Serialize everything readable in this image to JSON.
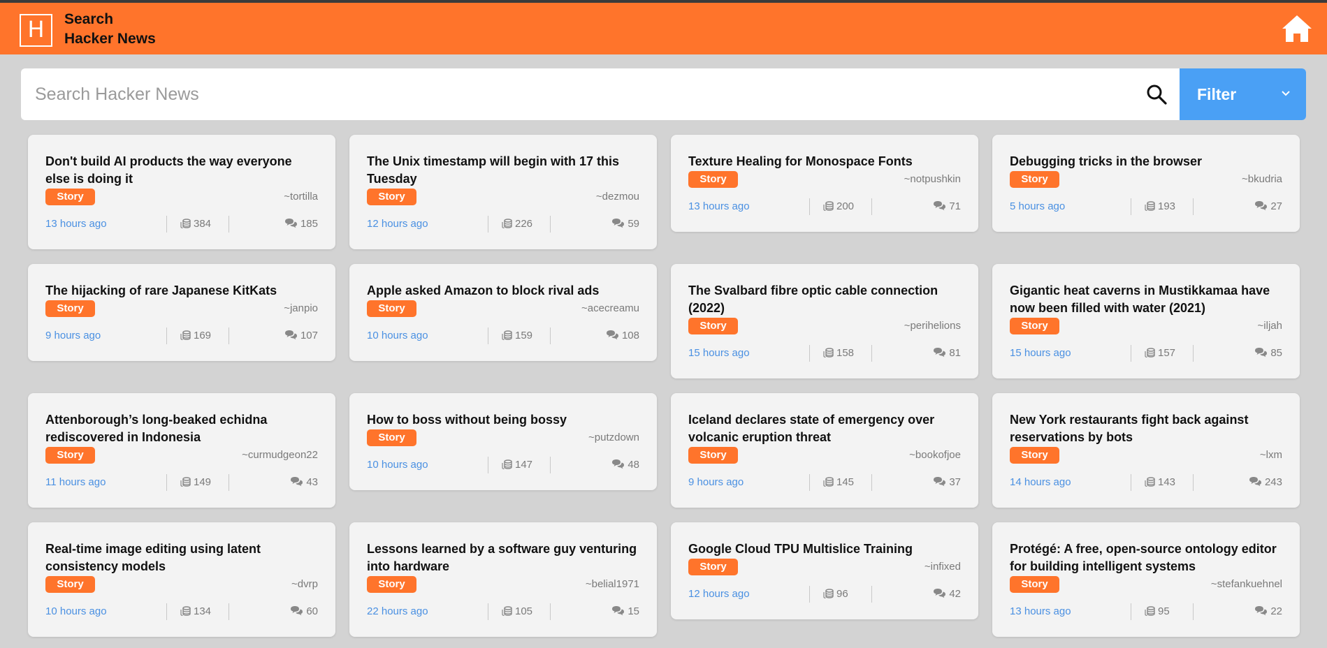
{
  "header": {
    "brand_line1": "Search",
    "brand_line2": "Hacker News",
    "logo_letter": "H"
  },
  "search": {
    "placeholder": "Search Hacker News",
    "filter_label": "Filter"
  },
  "colors": {
    "brand": "#ff742b",
    "filter": "#4aa0f5",
    "time": "#4a90e2"
  },
  "stories": [
    {
      "title": "Don't build AI products the way everyone else is doing it",
      "tag": "Story",
      "author": "~tortilla",
      "time": "13 hours ago",
      "points": "384",
      "comments": "185"
    },
    {
      "title": "The Unix timestamp will begin with 17 this Tuesday",
      "tag": "Story",
      "author": "~dezmou",
      "time": "12 hours ago",
      "points": "226",
      "comments": "59"
    },
    {
      "title": "Texture Healing for Monospace Fonts",
      "tag": "Story",
      "author": "~notpushkin",
      "time": "13 hours ago",
      "points": "200",
      "comments": "71"
    },
    {
      "title": "Debugging tricks in the browser",
      "tag": "Story",
      "author": "~bkudria",
      "time": "5 hours ago",
      "points": "193",
      "comments": "27"
    },
    {
      "title": "The hijacking of rare Japanese KitKats",
      "tag": "Story",
      "author": "~janpio",
      "time": "9 hours ago",
      "points": "169",
      "comments": "107"
    },
    {
      "title": "Apple asked Amazon to block rival ads",
      "tag": "Story",
      "author": "~acecreamu",
      "time": "10 hours ago",
      "points": "159",
      "comments": "108"
    },
    {
      "title": "The Svalbard fibre optic cable connection (2022)",
      "tag": "Story",
      "author": "~perihelions",
      "time": "15 hours ago",
      "points": "158",
      "comments": "81"
    },
    {
      "title": "Gigantic heat caverns in Mustikkamaa have now been filled with water (2021)",
      "tag": "Story",
      "author": "~iljah",
      "time": "15 hours ago",
      "points": "157",
      "comments": "85"
    },
    {
      "title": "Attenborough’s long-beaked echidna rediscovered in Indonesia",
      "tag": "Story",
      "author": "~curmudgeon22",
      "time": "11 hours ago",
      "points": "149",
      "comments": "43"
    },
    {
      "title": "How to boss without being bossy",
      "tag": "Story",
      "author": "~putzdown",
      "time": "10 hours ago",
      "points": "147",
      "comments": "48"
    },
    {
      "title": "Iceland declares state of emergency over volcanic eruption threat",
      "tag": "Story",
      "author": "~bookofjoe",
      "time": "9 hours ago",
      "points": "145",
      "comments": "37"
    },
    {
      "title": "New York restaurants fight back against reservations by bots",
      "tag": "Story",
      "author": "~lxm",
      "time": "14 hours ago",
      "points": "143",
      "comments": "243"
    },
    {
      "title": "Real-time image editing using latent consistency models",
      "tag": "Story",
      "author": "~dvrp",
      "time": "10 hours ago",
      "points": "134",
      "comments": "60"
    },
    {
      "title": "Lessons learned by a software guy venturing into hardware",
      "tag": "Story",
      "author": "~belial1971",
      "time": "22 hours ago",
      "points": "105",
      "comments": "15"
    },
    {
      "title": "Google Cloud TPU Multislice Training",
      "tag": "Story",
      "author": "~infixed",
      "time": "12 hours ago",
      "points": "96",
      "comments": "42"
    },
    {
      "title": "Protégé: A free, open-source ontology editor for building intelligent systems",
      "tag": "Story",
      "author": "~stefankuehnel",
      "time": "13 hours ago",
      "points": "95",
      "comments": "22"
    }
  ]
}
